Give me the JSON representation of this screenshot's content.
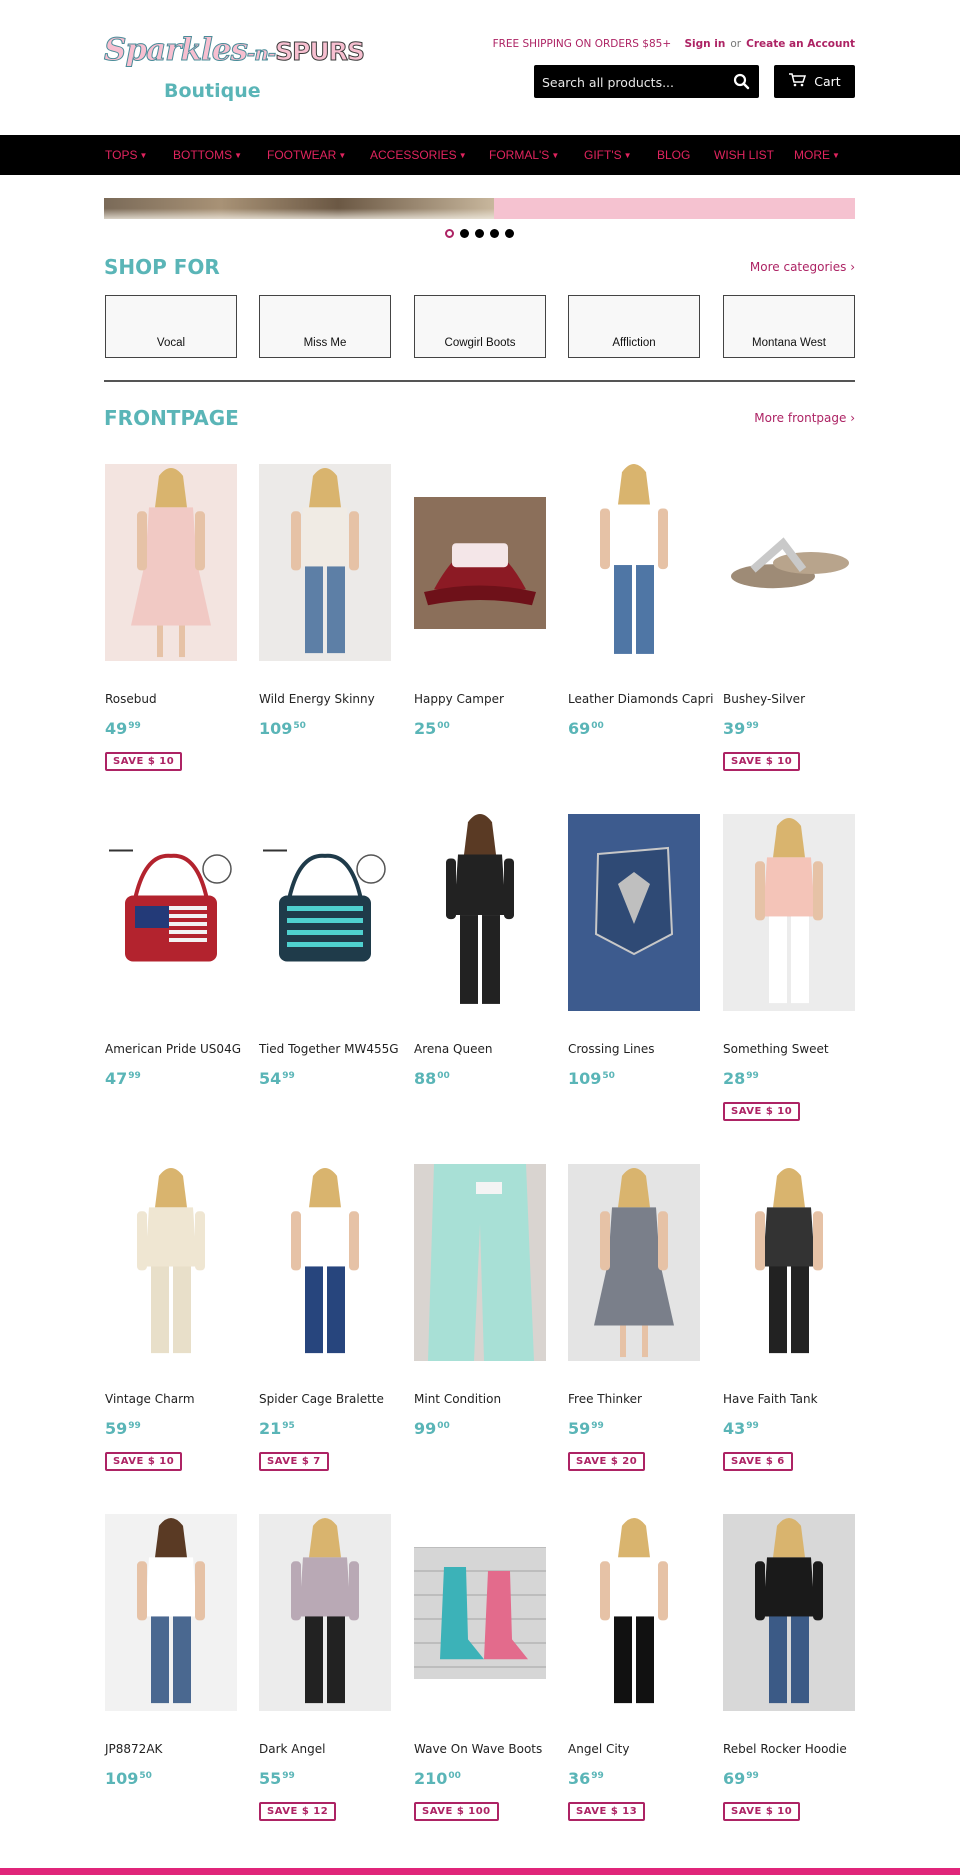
{
  "header": {
    "logo_line1_a": "Sparkles",
    "logo_line1_b": "-n-",
    "logo_line1_c": "SPURS",
    "logo_line2": "Boutique",
    "shipping": "FREE SHIPPING ON ORDERS $85+",
    "sign_in": "Sign in",
    "or": "or",
    "create_account": "Create an Account",
    "search_placeholder": "Search all products...",
    "cart_label": "Cart"
  },
  "nav": {
    "items": [
      {
        "label": "TOPS",
        "caret": true
      },
      {
        "label": "BOTTOMS",
        "caret": true
      },
      {
        "label": "FOOTWEAR",
        "caret": true
      },
      {
        "label": "ACCESSORIES",
        "caret": true
      },
      {
        "label": "FORMAL'S",
        "caret": true
      },
      {
        "label": "GIFT'S",
        "caret": true
      },
      {
        "label": "BLOG",
        "caret": false
      },
      {
        "label": "WISH LIST",
        "caret": false
      },
      {
        "label": "MORE",
        "caret": true
      }
    ]
  },
  "slideshow": {
    "slides": 5,
    "active": 0
  },
  "shop_for": {
    "title": "SHOP FOR",
    "more": "More categories ›",
    "categories": [
      "Vocal",
      "Miss Me",
      "Cowgirl Boots",
      "Affliction",
      "Montana West"
    ]
  },
  "frontpage": {
    "title": "FRONTPAGE",
    "more": "More frontpage ›",
    "products": [
      {
        "name": "Rosebud",
        "price_main": "49",
        "price_cents": "99",
        "save": "SAVE $ 10"
      },
      {
        "name": "Wild Energy Skinny",
        "price_main": "109",
        "price_cents": "50",
        "save": ""
      },
      {
        "name": "Happy Camper",
        "price_main": "25",
        "price_cents": "00",
        "save": ""
      },
      {
        "name": "Leather Diamonds Capri",
        "price_main": "69",
        "price_cents": "00",
        "save": ""
      },
      {
        "name": "Bushey-Silver",
        "price_main": "39",
        "price_cents": "99",
        "save": "SAVE $ 10"
      },
      {
        "name": "American Pride US04G",
        "price_main": "47",
        "price_cents": "99",
        "save": ""
      },
      {
        "name": "Tied Together MW455G",
        "price_main": "54",
        "price_cents": "99",
        "save": ""
      },
      {
        "name": "Arena Queen",
        "price_main": "88",
        "price_cents": "00",
        "save": ""
      },
      {
        "name": "Crossing Lines",
        "price_main": "109",
        "price_cents": "50",
        "save": ""
      },
      {
        "name": "Something Sweet",
        "price_main": "28",
        "price_cents": "99",
        "save": "SAVE $ 10"
      },
      {
        "name": "Vintage Charm",
        "price_main": "59",
        "price_cents": "99",
        "save": "SAVE $ 10"
      },
      {
        "name": "Spider Cage Bralette",
        "price_main": "21",
        "price_cents": "95",
        "save": "SAVE $ 7"
      },
      {
        "name": "Mint Condition",
        "price_main": "99",
        "price_cents": "00",
        "save": ""
      },
      {
        "name": "Free Thinker",
        "price_main": "59",
        "price_cents": "99",
        "save": "SAVE $ 20"
      },
      {
        "name": "Have Faith Tank",
        "price_main": "43",
        "price_cents": "99",
        "save": "SAVE $ 6"
      },
      {
        "name": "JP8872AK",
        "price_main": "109",
        "price_cents": "50",
        "save": ""
      },
      {
        "name": "Dark Angel",
        "price_main": "55",
        "price_cents": "99",
        "save": "SAVE $ 12"
      },
      {
        "name": "Wave On Wave Boots",
        "price_main": "210",
        "price_cents": "00",
        "save": "SAVE $ 100"
      },
      {
        "name": "Angel City",
        "price_main": "36",
        "price_cents": "99",
        "save": "SAVE $ 13"
      },
      {
        "name": "Rebel Rocker Hoodie",
        "price_main": "69",
        "price_cents": "99",
        "save": "SAVE $ 10"
      }
    ]
  },
  "colors": {
    "accent_pink": "#ad2364",
    "nav_pink": "#e0245e",
    "teal": "#5ab5b7",
    "nav_bg": "#000000"
  }
}
